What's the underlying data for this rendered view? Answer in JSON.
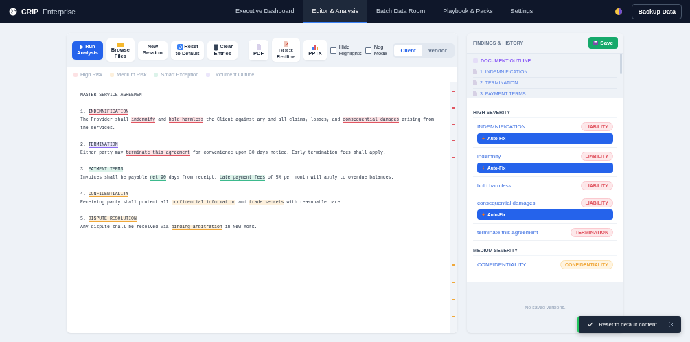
{
  "nav": {
    "brand": "CRIP",
    "edition": "Enterprise",
    "tabs": [
      {
        "label": "Executive Dashboard",
        "selected": false
      },
      {
        "label": "Editor & Analysis",
        "selected": true
      },
      {
        "label": "Batch Data Room",
        "selected": false
      },
      {
        "label": "Playbook & Packs",
        "selected": false
      },
      {
        "label": "Settings",
        "selected": false
      }
    ],
    "backup_button": "Backup Data"
  },
  "toolbar": {
    "buttons": [
      {
        "label": "Run Analysis",
        "kind": "primary"
      },
      {
        "label": "Browse Files",
        "kind": "default"
      },
      {
        "label": "New Session",
        "kind": "default"
      },
      {
        "label": "Reset to Default",
        "kind": "default"
      },
      {
        "label": "Clear Entries",
        "kind": "default"
      },
      {
        "label": "PDF",
        "kind": "export"
      },
      {
        "label": "DOCX Redline",
        "kind": "export"
      },
      {
        "label": "PPTX",
        "kind": "export"
      }
    ],
    "checkboxes": [
      {
        "label": "Hide Highlights",
        "checked": false
      },
      {
        "label": "Neg. Mode",
        "checked": false
      }
    ],
    "perspective": [
      {
        "label": "Client",
        "selected": true
      },
      {
        "label": "Vendor",
        "selected": false
      }
    ]
  },
  "legend": [
    {
      "label": "High Risk",
      "color": "#fde2e4"
    },
    {
      "label": "Medium Risk",
      "color": "#fdf0dc"
    },
    {
      "label": "Smart Exception",
      "color": "#dcf3ea"
    },
    {
      "label": "Document Outline",
      "color": "#ebe6fb"
    }
  ],
  "document": {
    "sections": [
      {
        "lines": [
          [
            {
              "text": "MASTER SERVICE AGREEMENT"
            }
          ]
        ]
      },
      {
        "lines": [
          [
            {
              "text": "1. "
            },
            {
              "text": "INDEMNIFICATION",
              "kind": "high"
            }
          ],
          [
            {
              "text": "The Provider shall "
            },
            {
              "text": "indemnify",
              "kind": "high"
            },
            {
              "text": " and "
            },
            {
              "text": "hold harmless",
              "kind": "high"
            },
            {
              "text": " the Client against any and all claims, losses, and "
            },
            {
              "text": "consequential damages",
              "kind": "high"
            },
            {
              "text": " arising from the services."
            }
          ]
        ]
      },
      {
        "lines": [
          [
            {
              "text": "2. "
            },
            {
              "text": "TERMINATION",
              "kind": "outline"
            }
          ],
          [
            {
              "text": "Either party may "
            },
            {
              "text": "terminate this agreement",
              "kind": "high"
            },
            {
              "text": " for convenience upon 30 days notice. Early termination fees shall apply."
            }
          ]
        ]
      },
      {
        "lines": [
          [
            {
              "text": "3. "
            },
            {
              "text": "PAYMENT TERMS",
              "kind": "exception"
            }
          ],
          [
            {
              "text": "Invoices shall be payable "
            },
            {
              "text": "net 90",
              "kind": "exception"
            },
            {
              "text": " days from receipt. "
            },
            {
              "text": "Late payment fees",
              "kind": "exception"
            },
            {
              "text": " of 5% per month will apply to overdue balances."
            }
          ]
        ]
      },
      {
        "lines": [
          [
            {
              "text": "4. "
            },
            {
              "text": "CONFIDENTIALITY",
              "kind": "medium"
            }
          ],
          [
            {
              "text": "Receiving party shall protect all "
            },
            {
              "text": "confidential information",
              "kind": "medium"
            },
            {
              "text": " and "
            },
            {
              "text": "trade secrets",
              "kind": "medium"
            },
            {
              "text": " with reasonable care."
            }
          ]
        ]
      },
      {
        "lines": [
          [
            {
              "text": "5. "
            },
            {
              "text": "DISPUTE RESOLUTION",
              "kind": "medium"
            }
          ],
          [
            {
              "text": "Any dispute shall be resolved via "
            },
            {
              "text": "binding arbitration",
              "kind": "medium"
            },
            {
              "text": " in New York."
            }
          ]
        ]
      }
    ]
  },
  "panel": {
    "title": "FINDINGS & HISTORY",
    "save_button": "Save",
    "outline": {
      "heading": "DOCUMENT OUTLINE",
      "items": [
        "1. INDEMNIFICATION...",
        "2. TERMINATION...",
        "3. PAYMENT TERMS"
      ]
    },
    "groups": [
      {
        "title": "HIGH SEVERITY",
        "kind": "high",
        "findings": [
          {
            "name": "INDEMNIFICATION",
            "tag": "LIABILITY",
            "action": "Auto-Fix"
          },
          {
            "name": "indemnify",
            "tag": "LIABILITY",
            "action": "Auto-Fix"
          },
          {
            "name": "hold harmless",
            "tag": "LIABILITY"
          },
          {
            "name": "consequential damages",
            "tag": "LIABILITY",
            "action": "Auto-Fix"
          },
          {
            "name": "terminate this agreement",
            "tag": "TERMINATION"
          }
        ]
      },
      {
        "title": "MEDIUM SEVERITY",
        "kind": "medium",
        "findings": [
          {
            "name": "CONFIDENTIALITY",
            "tag": "CONFIDENTIALITY"
          }
        ]
      }
    ],
    "history_empty": "No saved versions."
  },
  "toast": {
    "message": "Reset to default content."
  }
}
